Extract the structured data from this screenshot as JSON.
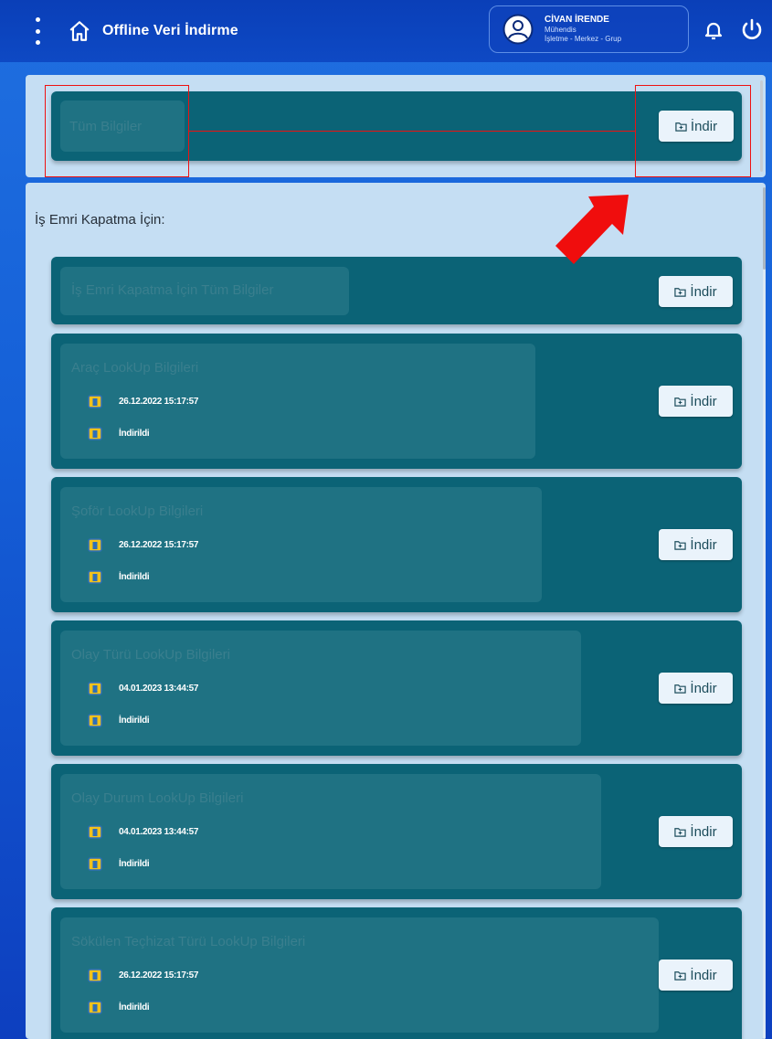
{
  "header": {
    "title": "Offline Veri İndirme",
    "user": {
      "name": "CİVAN İRENDE",
      "role": "Mühendis",
      "org": "İşletme - Merkez - Grup"
    }
  },
  "top": {
    "label": "Tüm Bilgiler",
    "button": "İndir"
  },
  "section": {
    "title": "İş Emri Kapatma İçin:",
    "all_card": {
      "label": "İş Emri Kapatma İçin Tüm Bilgiler",
      "button": "İndir"
    },
    "items": [
      {
        "title": "Araç LookUp Bilgileri",
        "date": "26.12.2022 15:17:57",
        "status": "İndirildi",
        "button": "İndir"
      },
      {
        "title": "Şoför LookUp Bilgileri",
        "date": "26.12.2022 15:17:57",
        "status": "İndirildi",
        "button": "İndir"
      },
      {
        "title": "Olay Türü LookUp Bilgileri",
        "date": "04.01.2023 13:44:57",
        "status": "İndirildi",
        "button": "İndir"
      },
      {
        "title": "Olay Durum LookUp Bilgileri",
        "date": "04.01.2023 13:44:57",
        "status": "İndirildi",
        "button": "İndir"
      },
      {
        "title": "Sökülen Teçhizat Türü LookUp Bilgileri",
        "date": "26.12.2022 15:17:57",
        "status": "İndirildi",
        "button": "İndir"
      }
    ]
  },
  "colors": {
    "card": "#0b6376",
    "panel": "#c5def3",
    "accent_annotation": "#e11111"
  }
}
